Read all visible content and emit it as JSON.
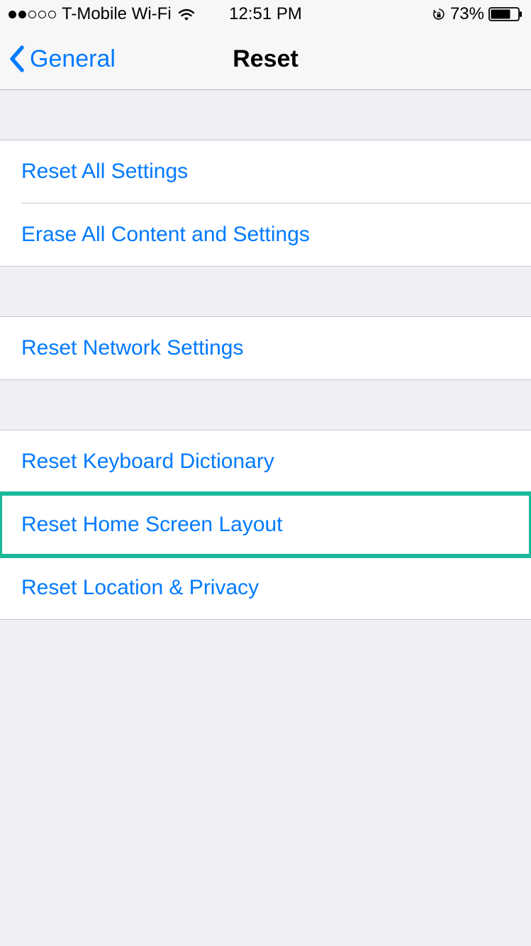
{
  "statusBar": {
    "carrier": "T-Mobile Wi-Fi",
    "time": "12:51 PM",
    "batteryPercent": "73%"
  },
  "nav": {
    "backLabel": "General",
    "title": "Reset"
  },
  "sections": [
    {
      "rows": [
        {
          "label": "Reset All Settings"
        },
        {
          "label": "Erase All Content and Settings"
        }
      ]
    },
    {
      "rows": [
        {
          "label": "Reset Network Settings"
        }
      ]
    },
    {
      "rows": [
        {
          "label": "Reset Keyboard Dictionary"
        },
        {
          "label": "Reset Home Screen Layout",
          "highlighted": true
        },
        {
          "label": "Reset Location & Privacy"
        }
      ]
    }
  ]
}
